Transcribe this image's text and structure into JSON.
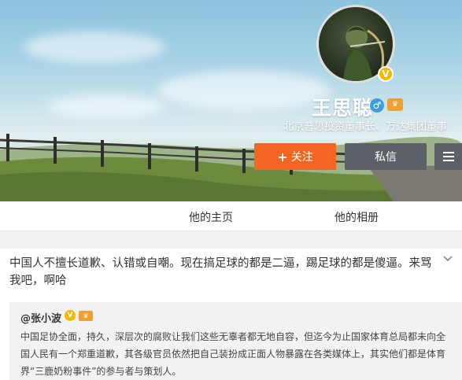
{
  "profile": {
    "name": "王思聪",
    "description": "北京普思投资董事长、万达集团董事",
    "gender": "male",
    "verified_icon": "v-badge-icon",
    "gender_symbol": "♂",
    "level_symbol": "♛"
  },
  "actions": {
    "follow_label": "关注",
    "follow_plus": "+",
    "message_label": "私信"
  },
  "tabs": [
    {
      "label": "他的主页"
    },
    {
      "label": "他的相册"
    }
  ],
  "post": {
    "text": "中国人不擅长道歉、认错或自嘲。现在搞足球的都是二逼，踢足球的都是傻逼。来骂我吧，啊哈",
    "repost": {
      "author": "@张小波",
      "v_symbol": "V",
      "level_symbol": "♛",
      "text": "中国足协全面，持久，深层次的腐败让我们这些无辜者都无地自容，但迄今为止国家体育总局都未向全国人民有一个郑重道歉，其各级官员依然把自己装扮成正面人物暴露在各类媒体上，其实他们都是体育界“三鹿奶粉事件”的参与者与策划人。"
    }
  },
  "colors": {
    "follow": "#f26522",
    "message": "#5c6168",
    "verified": "#f5b800",
    "repost_bg": "#f2f2f5"
  }
}
